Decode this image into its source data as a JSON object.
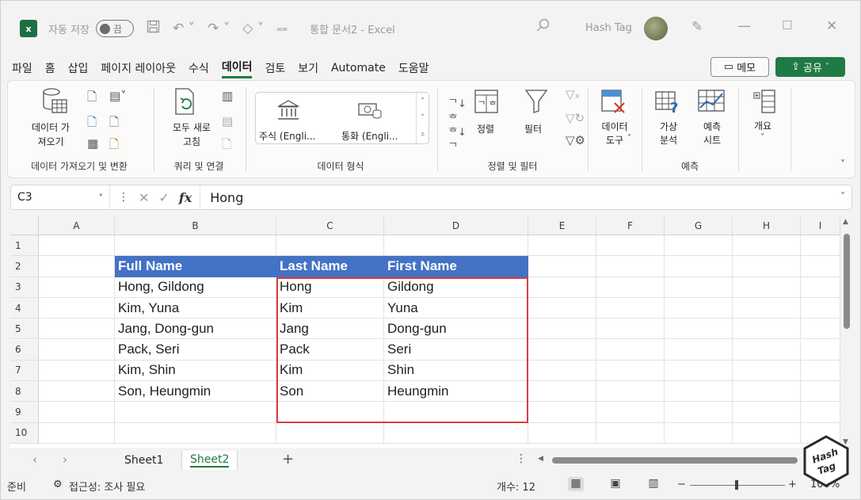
{
  "titlebar": {
    "autosave_label": "자동 저장",
    "autosave_state": "끔",
    "doc_title": "통합 문서2 - Excel",
    "user_name": "Hash Tag",
    "app_logo_text": "x"
  },
  "menu": {
    "items": [
      "파일",
      "홈",
      "삽입",
      "페이지 레이아웃",
      "수식",
      "데이터",
      "검토",
      "보기",
      "Automate",
      "도움말"
    ],
    "active": "데이터",
    "memo_label": "메모",
    "share_label": "공유"
  },
  "ribbon": {
    "get_data_label": "데이터 가\n져오기",
    "group1_label": "데이터 가져오기 및 변환",
    "refresh_all_label": "모두 새로\n고침",
    "group2_label": "쿼리 및 연결",
    "stocks_label": "주식 (Engli...",
    "currency_label": "통화 (Engli...",
    "group3_label": "데이터 형식",
    "sort_label": "정렬",
    "filter_label": "필터",
    "group4_label": "정렬 및 필터",
    "data_tools_label": "데이터\n도구",
    "whatif_label": "가상\n분석",
    "forecast_label": "예측\n시트",
    "group5_label": "예측",
    "outline_label": "개요"
  },
  "formula_bar": {
    "name_box": "C3",
    "fx_label": "fx",
    "value": "Hong"
  },
  "grid": {
    "columns": [
      "A",
      "B",
      "C",
      "D",
      "E",
      "F",
      "G",
      "H",
      "I"
    ],
    "rows": [
      "1",
      "2",
      "3",
      "4",
      "5",
      "6",
      "7",
      "8",
      "9",
      "10"
    ],
    "table_headers": [
      "Full Name",
      "Last Name",
      "First Name"
    ],
    "table_rows": [
      [
        "Hong, Gildong",
        "Hong",
        "Gildong"
      ],
      [
        "Kim, Yuna",
        "Kim",
        "Yuna"
      ],
      [
        "Jang, Dong-gun",
        "Jang",
        "Dong-gun"
      ],
      [
        "Pack, Seri",
        "Pack",
        "Seri"
      ],
      [
        "Kim, Shin",
        "Kim",
        "Shin"
      ],
      [
        "Son, Heungmin",
        "Son",
        "Heungmin"
      ]
    ],
    "header_color": "#4472c4",
    "highlight_color": "#e03c3c"
  },
  "sheets": {
    "tabs": [
      "Sheet1",
      "Sheet2"
    ],
    "active": "Sheet2",
    "add_label": "+"
  },
  "statusbar": {
    "ready": "준비",
    "accessibility": "접근성: 조사 필요",
    "count": "개수: 12",
    "zoom": "100%"
  },
  "watermark": {
    "text": "Hash Tag"
  }
}
